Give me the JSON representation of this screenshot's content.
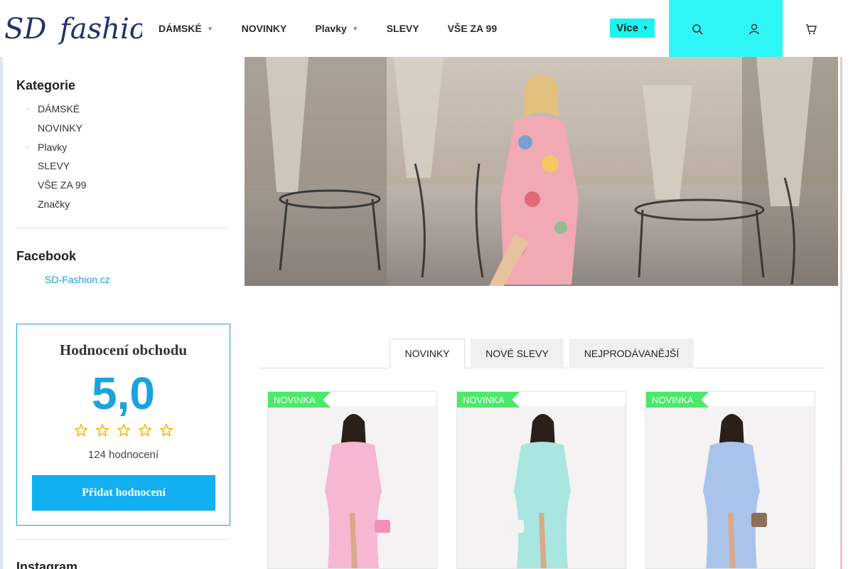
{
  "header": {
    "nav": [
      {
        "label": "DÁMSKÉ",
        "has_dropdown": true
      },
      {
        "label": "NOVINKY",
        "has_dropdown": false
      },
      {
        "label": "Plavky",
        "has_dropdown": true
      },
      {
        "label": "SLEVY",
        "has_dropdown": false
      },
      {
        "label": "VŠE ZA 99",
        "has_dropdown": false
      }
    ],
    "more_label": "Více",
    "accent_color": "#2ef6f6",
    "icons": [
      "search-icon",
      "user-icon",
      "cart-icon"
    ]
  },
  "sidebar": {
    "categories_title": "Kategorie",
    "categories": [
      {
        "label": "DÁMSKÉ",
        "expandable": true
      },
      {
        "label": "NOVINKY",
        "expandable": false
      },
      {
        "label": "Plavky",
        "expandable": true
      },
      {
        "label": "SLEVY",
        "expandable": false
      },
      {
        "label": "VŠE ZA 99",
        "expandable": false
      },
      {
        "label": "Značky",
        "expandable": false
      }
    ],
    "facebook_title": "Facebook",
    "facebook_link": "SD-Fashion.cz",
    "instagram_title": "Instagram"
  },
  "rating": {
    "title": "Hodnocení obchodu",
    "score": "5,0",
    "stars": 5,
    "count": "124 hodnocení",
    "button": "Přidat hodnocení",
    "accent_color": "#1aa3dd"
  },
  "tabs": [
    {
      "label": "NOVINKY",
      "active": true
    },
    {
      "label": "NOVÉ SLEVY",
      "active": false
    },
    {
      "label": "NEJPRODÁVANĚJŠÍ",
      "active": false
    }
  ],
  "products": [
    {
      "badge": "NOVINKA",
      "color": "#f6b7d2"
    },
    {
      "badge": "NOVINKA",
      "color": "#a8e6df"
    },
    {
      "badge": "NOVINKA",
      "color": "#a9c4ea"
    }
  ]
}
